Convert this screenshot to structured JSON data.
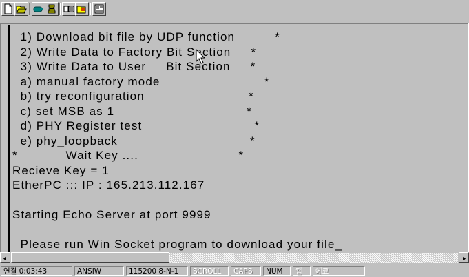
{
  "toolbar": {
    "buttons": [
      {
        "name": "new-icon"
      },
      {
        "name": "open-icon"
      },
      {
        "name": "connect-icon"
      },
      {
        "name": "disconnect-icon"
      },
      {
        "name": "send-icon"
      },
      {
        "name": "receive-icon"
      },
      {
        "name": "properties-icon"
      }
    ]
  },
  "terminal": {
    "lines": [
      "  1) Download bit file by UDP function          *",
      "  2) Write Data to Factory Bit Section     *",
      "  3) Write Data to User     Bit Section     *",
      "  a) manual factory mode                          *",
      "  b) try reconfiguration                          *",
      "  c) set MSB as 1                                 *",
      "  d) PHY Register test                            *",
      "  e) phy_loopback                                 *",
      "*            Wait Key ....                         *",
      "Recieve Key = 1",
      "EtherPC ::: IP : 165.213.112.167",
      "",
      "Starting Echo Server at port 9999",
      "",
      "  Please run Win Socket program to download your file_"
    ]
  },
  "statusbar": {
    "connected": "연결 0:03:43",
    "emulation": "ANSIW",
    "port_settings": "115200 8-N-1",
    "scroll": "SCROLL",
    "caps": "CAPS",
    "num": "NUM",
    "capture": "캡",
    "echo": "에코"
  }
}
